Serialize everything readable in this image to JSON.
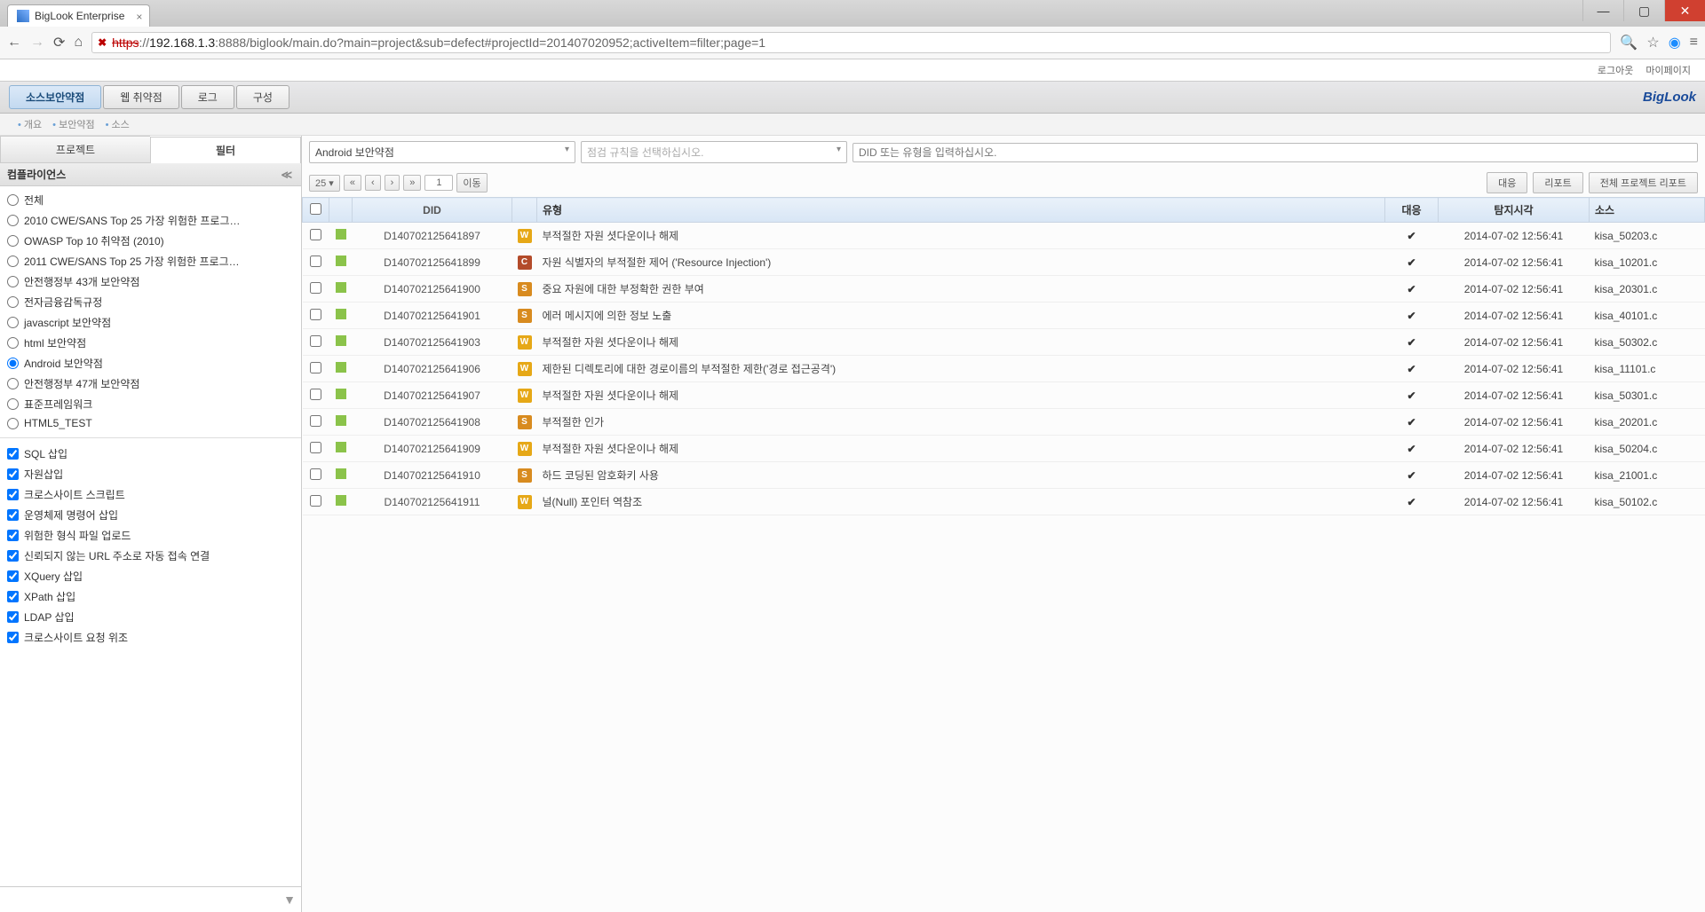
{
  "browser": {
    "tab_title": "BigLook Enterprise",
    "url_https": "https",
    "url_rest": "://",
    "url_host": "192.168.1.3",
    "url_path": ":8888/biglook/main.do?main=project&sub=defect#projectId=201407020952;activeItem=filter;page=1"
  },
  "top_links": {
    "logout": "로그아웃",
    "mypage": "마이페이지"
  },
  "brand": "BigLook",
  "main_tabs": [
    {
      "label": "소스보안약점",
      "active": true
    },
    {
      "label": "웹 취약점",
      "active": false
    },
    {
      "label": "로그",
      "active": false
    },
    {
      "label": "구성",
      "active": false
    }
  ],
  "breadcrumb": [
    "개요",
    "보안약점",
    "소스"
  ],
  "side_tabs": {
    "project": "프로젝트",
    "filter": "필터"
  },
  "side_header": "컴플라이언스",
  "compliance_items": [
    {
      "label": "전체",
      "selected": false
    },
    {
      "label": "2010 CWE/SANS Top 25 가장 위험한 프로그…",
      "selected": false
    },
    {
      "label": "OWASP Top 10 취약점 (2010)",
      "selected": false
    },
    {
      "label": "2011 CWE/SANS Top 25 가장 위험한 프로그…",
      "selected": false
    },
    {
      "label": "안전행정부 43개 보안약점",
      "selected": false
    },
    {
      "label": "전자금융감독규정",
      "selected": false
    },
    {
      "label": "javascript 보안약점",
      "selected": false
    },
    {
      "label": "html 보안약점",
      "selected": false
    },
    {
      "label": "Android 보안약점",
      "selected": true
    },
    {
      "label": "안전행정부 47개 보안약점",
      "selected": false
    },
    {
      "label": "표준프레임워크",
      "selected": false
    },
    {
      "label": "HTML5_TEST",
      "selected": false
    }
  ],
  "check_items": [
    "SQL 삽입",
    "자원삽입",
    "크로스사이트 스크립트",
    "운영체제 명령어 삽입",
    "위험한 형식 파일 업로드",
    "신뢰되지 않는 URL 주소로 자동 접속 연결",
    "XQuery 삽입",
    "XPath 삽입",
    "LDAP 삽입",
    "크로스사이트 요청 위조"
  ],
  "toolbar": {
    "combo1": "Android 보안약점",
    "combo2_placeholder": "점검 규칙을 선택하십시오.",
    "search_placeholder": "DID 또는 유형을 입력하십시오."
  },
  "pager": {
    "page_size": "25",
    "page_num": "1",
    "go": "이동",
    "btn_resp": "대응",
    "btn_report": "리포트",
    "btn_full_report": "전체 프로젝트 리포트"
  },
  "columns": {
    "did": "DID",
    "type": "유형",
    "resp": "대응",
    "time": "탐지시각",
    "src": "소스"
  },
  "rows": [
    {
      "did": "D140702125641897",
      "tag": "W",
      "type": "부적절한 자원 셧다운이나 해제",
      "time": "2014-07-02 12:56:41",
      "src": "kisa_50203.c"
    },
    {
      "did": "D140702125641899",
      "tag": "C",
      "type": "자원 식별자의 부적절한 제어 ('Resource Injection')",
      "time": "2014-07-02 12:56:41",
      "src": "kisa_10201.c"
    },
    {
      "did": "D140702125641900",
      "tag": "S",
      "type": "중요 자원에 대한 부정확한 권한 부여",
      "time": "2014-07-02 12:56:41",
      "src": "kisa_20301.c"
    },
    {
      "did": "D140702125641901",
      "tag": "S",
      "type": "에러 메시지에 의한 정보 노출",
      "time": "2014-07-02 12:56:41",
      "src": "kisa_40101.c"
    },
    {
      "did": "D140702125641903",
      "tag": "W",
      "type": "부적절한 자원 셧다운이나 해제",
      "time": "2014-07-02 12:56:41",
      "src": "kisa_50302.c"
    },
    {
      "did": "D140702125641906",
      "tag": "W",
      "type": "제한된 디렉토리에 대한 경로이름의 부적절한 제한('경로 접근공격')",
      "time": "2014-07-02 12:56:41",
      "src": "kisa_11101.c"
    },
    {
      "did": "D140702125641907",
      "tag": "W",
      "type": "부적절한 자원 셧다운이나 해제",
      "time": "2014-07-02 12:56:41",
      "src": "kisa_50301.c"
    },
    {
      "did": "D140702125641908",
      "tag": "S",
      "type": "부적절한 인가",
      "time": "2014-07-02 12:56:41",
      "src": "kisa_20201.c"
    },
    {
      "did": "D140702125641909",
      "tag": "W",
      "type": "부적절한 자원 셧다운이나 해제",
      "time": "2014-07-02 12:56:41",
      "src": "kisa_50204.c"
    },
    {
      "did": "D140702125641910",
      "tag": "S",
      "type": "하드 코딩된 암호화키 사용",
      "time": "2014-07-02 12:56:41",
      "src": "kisa_21001.c"
    },
    {
      "did": "D140702125641911",
      "tag": "W",
      "type": "널(Null) 포인터 역참조",
      "time": "2014-07-02 12:56:41",
      "src": "kisa_50102.c"
    }
  ]
}
